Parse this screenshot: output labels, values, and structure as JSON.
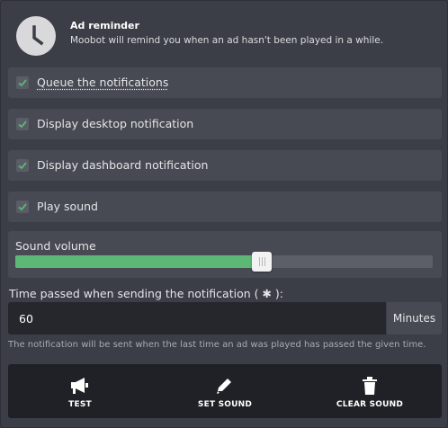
{
  "header": {
    "title": "Ad reminder",
    "description": "Moobot will remind you when an ad hasn't been played in a while.",
    "icon": "clock-icon"
  },
  "options": [
    {
      "label": "Queue the notifications",
      "checked": true
    },
    {
      "label": "Display desktop notification",
      "checked": true
    },
    {
      "label": "Display dashboard notification",
      "checked": true
    },
    {
      "label": "Play sound",
      "checked": true
    }
  ],
  "volume": {
    "label": "Sound volume",
    "level_fraction": 0.59,
    "fill_color": "#5cb874"
  },
  "time": {
    "label": "Time passed when sending the notification ( ✱ ):",
    "value": "60",
    "unit": "Minutes",
    "help": "The notification will be sent when the last time an ad was played has passed the given time."
  },
  "actions": {
    "test_label": "TEST",
    "set_sound_label": "SET SOUND",
    "clear_sound_label": "CLEAR SOUND"
  },
  "colors": {
    "background": "#3b3e46",
    "panel": "#474a52",
    "accent_check": "#5cb874"
  }
}
